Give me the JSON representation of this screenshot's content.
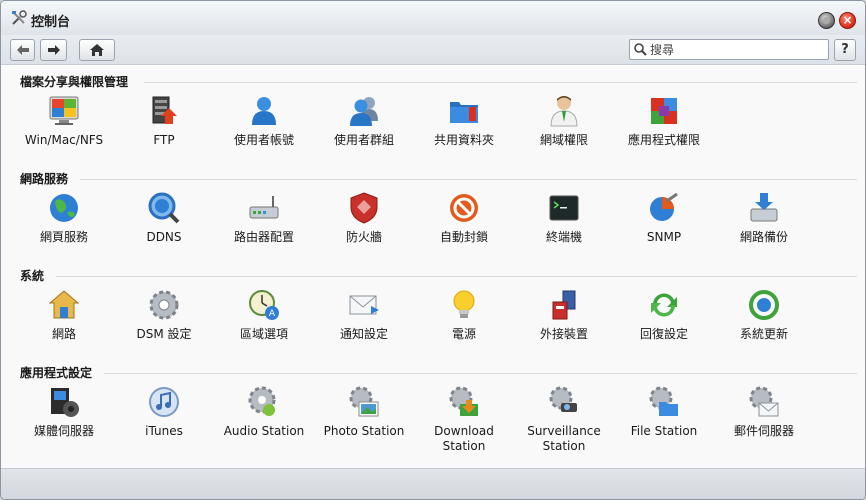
{
  "window": {
    "title": "控制台"
  },
  "toolbar": {
    "search_placeholder": "搜尋",
    "help_label": "?"
  },
  "sections": [
    {
      "title": "檔案分享與權限管理",
      "items": [
        {
          "label": "Win/Mac/NFS",
          "icon": "win-mac-nfs-icon"
        },
        {
          "label": "FTP",
          "icon": "ftp-icon"
        },
        {
          "label": "使用者帳號",
          "icon": "user-icon"
        },
        {
          "label": "使用者群組",
          "icon": "user-group-icon"
        },
        {
          "label": "共用資料夾",
          "icon": "shared-folder-icon"
        },
        {
          "label": "網域權限",
          "icon": "domain-privilege-icon"
        },
        {
          "label": "應用程式權限",
          "icon": "app-privilege-icon"
        }
      ]
    },
    {
      "title": "網路服務",
      "items": [
        {
          "label": "網頁服務",
          "icon": "web-services-icon"
        },
        {
          "label": "DDNS",
          "icon": "ddns-icon"
        },
        {
          "label": "路由器配置",
          "icon": "router-icon"
        },
        {
          "label": "防火牆",
          "icon": "firewall-icon"
        },
        {
          "label": "自動封鎖",
          "icon": "auto-block-icon"
        },
        {
          "label": "終端機",
          "icon": "terminal-icon"
        },
        {
          "label": "SNMP",
          "icon": "snmp-icon"
        },
        {
          "label": "網路備份",
          "icon": "network-backup-icon"
        }
      ]
    },
    {
      "title": "系統",
      "items": [
        {
          "label": "網路",
          "icon": "network-icon"
        },
        {
          "label": "DSM 設定",
          "icon": "dsm-settings-icon"
        },
        {
          "label": "區域選項",
          "icon": "regional-options-icon"
        },
        {
          "label": "通知設定",
          "icon": "notification-icon"
        },
        {
          "label": "電源",
          "icon": "power-icon"
        },
        {
          "label": "外接裝置",
          "icon": "external-devices-icon"
        },
        {
          "label": "回復設定",
          "icon": "restore-icon"
        },
        {
          "label": "系統更新",
          "icon": "system-update-icon"
        }
      ]
    },
    {
      "title": "應用程式設定",
      "items": [
        {
          "label": "媒體伺服器",
          "icon": "media-server-icon"
        },
        {
          "label": "iTunes",
          "icon": "itunes-icon"
        },
        {
          "label": "Audio Station",
          "icon": "audio-station-icon"
        },
        {
          "label": "Photo Station",
          "icon": "photo-station-icon"
        },
        {
          "label": "Download Station",
          "icon": "download-station-icon"
        },
        {
          "label": "Surveillance Station",
          "icon": "surveillance-station-icon"
        },
        {
          "label": "File Station",
          "icon": "file-station-icon"
        },
        {
          "label": "郵件伺服器",
          "icon": "mail-server-icon"
        }
      ]
    }
  ]
}
